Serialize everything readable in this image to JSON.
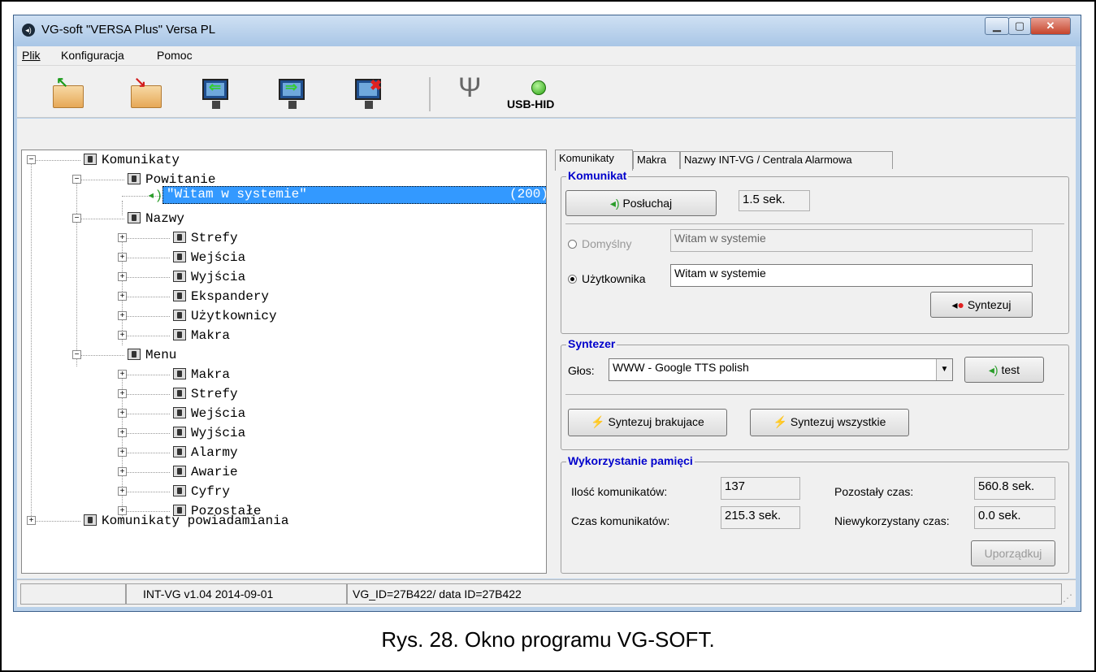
{
  "window": {
    "title": "VG-soft \"VERSA Plus\" Versa  PL",
    "app_icon": "speaker-icon"
  },
  "menu": [
    "Plik",
    "Konfiguracja",
    "Pomoc"
  ],
  "toolbar": {
    "connection_label": "USB-HID",
    "connection_status_color": "#2aa312"
  },
  "tree": {
    "root": "Komunikaty",
    "powitanie": "Powitanie",
    "selected_item": "\"Witam w systemie\"",
    "selected_count": "(200)",
    "nazwy": "Nazwy",
    "nazwy_children": [
      "Strefy",
      "Wejścia",
      "Wyjścia",
      "Ekspandery",
      "Użytkownicy",
      "Makra"
    ],
    "menu": "Menu",
    "menu_children": [
      "Makra",
      "Strefy",
      "Wejścia",
      "Wyjścia",
      "Alarmy",
      "Awarie",
      "Cyfry",
      "Pozostałe"
    ],
    "powiadamiania": "Komunikaty powiadamiania"
  },
  "tabs": [
    "Komunikaty",
    "Makra",
    "Nazwy INT-VG / Centrala Alarmowa"
  ],
  "komunikat": {
    "title": "Komunikat",
    "listen_button": "Posłuchaj",
    "duration": "1.5 sek.",
    "default_label": "Domyślny",
    "default_value": "Witam w systemie",
    "user_label": "Użytkownika",
    "user_value": "Witam w systemie",
    "synth_button": "Syntezuj"
  },
  "syntezer": {
    "title": "Syntezer",
    "voice_label": "Głos:",
    "voice_value": "WWW - Google TTS  polish",
    "test_button": "test",
    "missing_button": "Syntezuj brakujace",
    "all_button": "Syntezuj wszystkie"
  },
  "memory": {
    "title": "Wykorzystanie pamięci",
    "count_label": "Ilość komunikatów:",
    "count_value": "137",
    "time_label": "Czas komunikatów:",
    "time_value": "215.3 sek.",
    "remaining_label": "Pozostały czas:",
    "remaining_value": "560.8 sek.",
    "unused_label": "Niewykorzystany czas:",
    "unused_value": "0.0 sek.",
    "order_button": "Uporządkuj"
  },
  "status": {
    "version": "INT-VG v1.04 2014-09-01",
    "ids": "VG_ID=27B422/ data ID=27B422"
  },
  "caption": "Rys. 28. Okno programu VG-SOFT."
}
